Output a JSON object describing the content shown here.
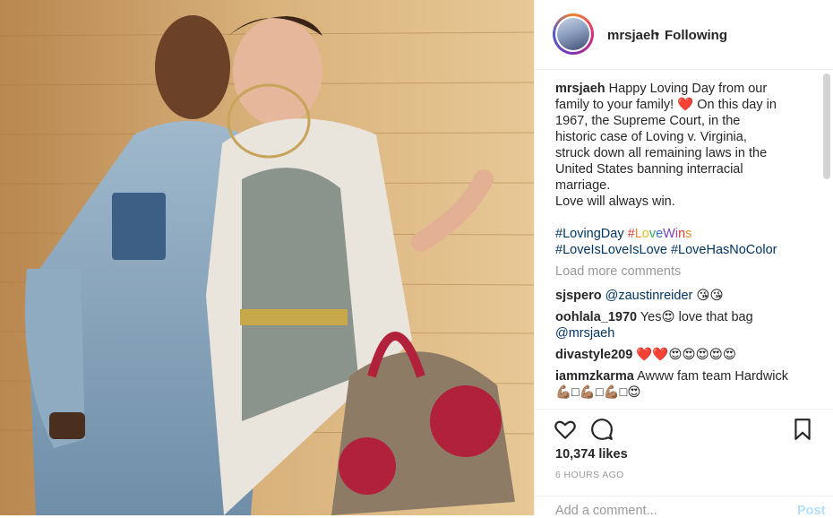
{
  "header": {
    "username": "mrsjaeh",
    "separator": "•",
    "follow_status": "Following"
  },
  "caption": {
    "username": "mrsjaeh",
    "text_lines": [
      "Happy Loving Day from our",
      "family to your family! ❤️ On this day in",
      "1967, the Supreme Court, in the",
      "historic case of Loving v. Virginia,",
      "struck down all remaining laws in the",
      "United States banning interracial",
      "marriage.",
      "Love will always win."
    ],
    "tag_loving_day": "#LovingDay",
    "tag_love_wins": "#LoveWins",
    "tag_line2": "#LoveIsLoveIsLove #LoveHasNoColor"
  },
  "load_more": "Load more comments",
  "comments": [
    {
      "user": "sjspero",
      "mention": "@zaustinreider",
      "text": " 😘😘"
    },
    {
      "user": "oohlala_1970",
      "text": " Yes😍 love that bag",
      "mention": "@mrsjaeh"
    },
    {
      "user": "divastyle209",
      "text": " ❤️❤️😍😍😍😍😍"
    },
    {
      "user": "iammzkarma",
      "text": " Awww fam team Hardwick",
      "text2": "💪🏽□💪🏽□💪🏽□😍"
    }
  ],
  "actions": {
    "likes": "10,374 likes",
    "timestamp": "6 HOURS AGO",
    "add_comment_placeholder": "Add a comment...",
    "post_label": "Post"
  },
  "icons": {
    "like": "heart-icon",
    "comment": "comment-icon",
    "save": "bookmark-icon"
  },
  "colors": {
    "link": "#003569",
    "muted": "#999999",
    "text": "#262626"
  }
}
